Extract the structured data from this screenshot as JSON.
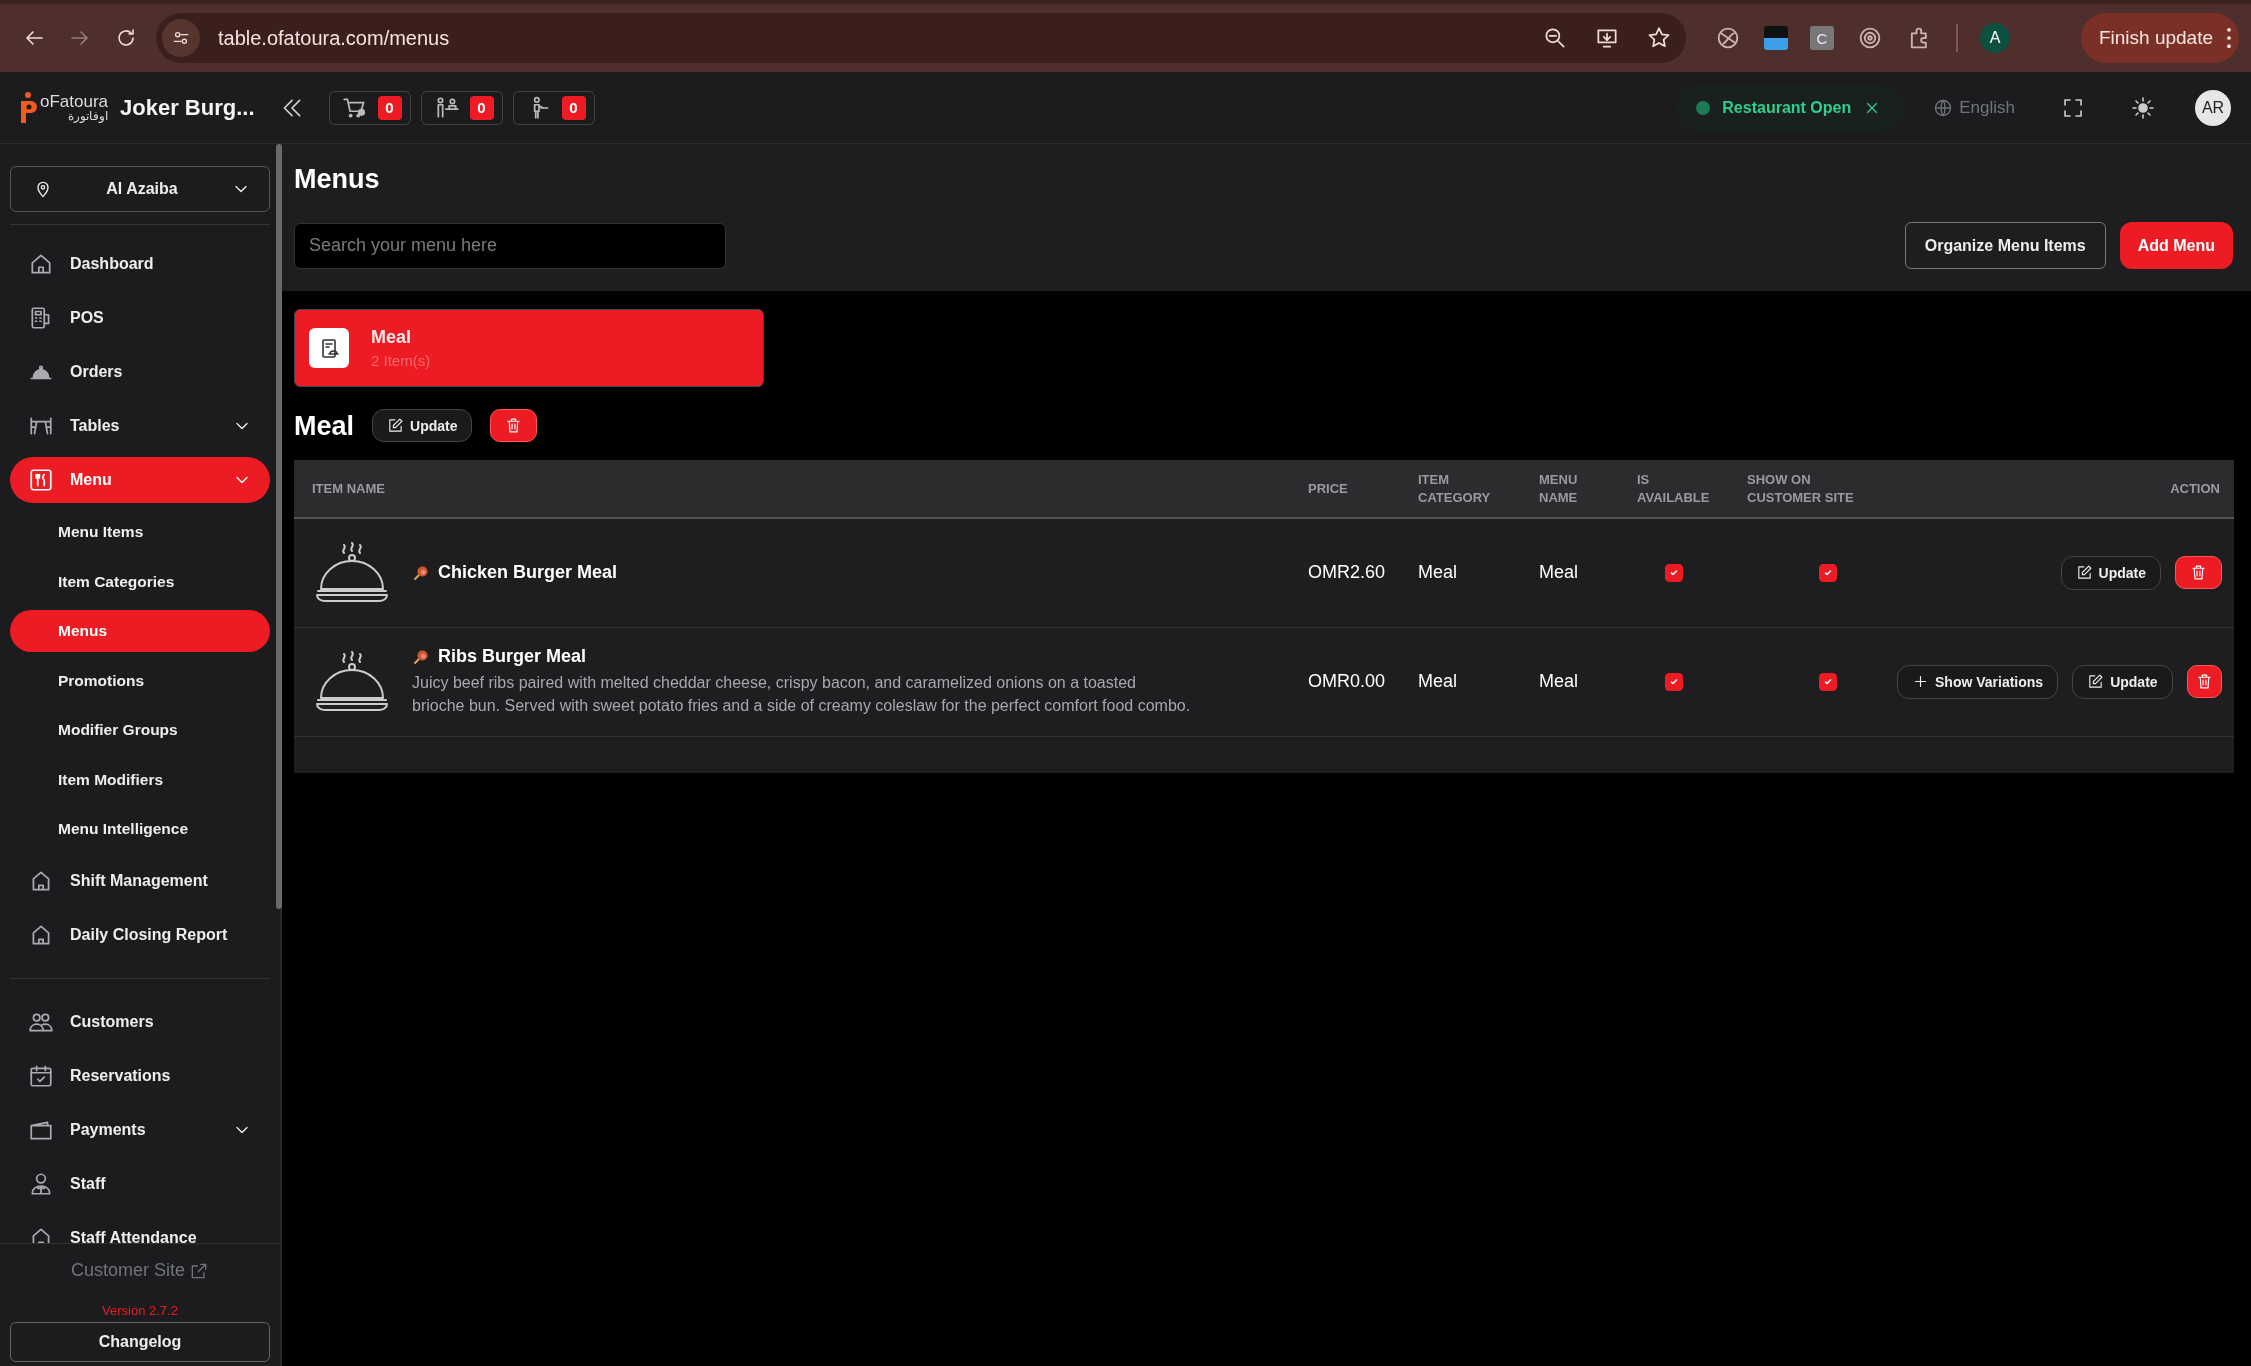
{
  "browser": {
    "url": "table.ofatoura.com/menus",
    "extension_letter": "C",
    "profile_initial": "A",
    "update_button": "Finish update"
  },
  "header": {
    "brand": "oFatoura",
    "brand_arabic": "اوفاتورة",
    "restaurant": "Joker Burg...",
    "counters": [
      {
        "kind": "cart",
        "count": "0"
      },
      {
        "kind": "dine_in",
        "count": "0"
      },
      {
        "kind": "waiter",
        "count": "0"
      }
    ],
    "status": {
      "label": "Restaurant Open",
      "open": true
    },
    "language": "English",
    "avatar": "AR"
  },
  "sidebar": {
    "branch": "Al Azaiba",
    "sections": [
      [
        {
          "label": "Dashboard",
          "kind": "link",
          "selected": false
        },
        {
          "label": "POS",
          "kind": "link",
          "selected": false
        },
        {
          "label": "Orders",
          "kind": "link",
          "selected": false
        },
        {
          "label": "Tables",
          "kind": "group",
          "selected": false
        },
        {
          "label": "Menu",
          "kind": "group",
          "selected": true,
          "children": [
            {
              "label": "Menu Items",
              "selected": false
            },
            {
              "label": "Item Categories",
              "selected": false
            },
            {
              "label": "Menus",
              "selected": true
            },
            {
              "label": "Promotions",
              "selected": false
            },
            {
              "label": "Modifier Groups",
              "selected": false
            },
            {
              "label": "Item Modifiers",
              "selected": false
            },
            {
              "label": "Menu Intelligence",
              "selected": false
            }
          ]
        },
        {
          "label": "Shift Management",
          "kind": "link",
          "selected": false
        },
        {
          "label": "Daily Closing Report",
          "kind": "link",
          "selected": false
        }
      ],
      [
        {
          "label": "Customers",
          "kind": "link",
          "selected": false
        },
        {
          "label": "Reservations",
          "kind": "link",
          "selected": false
        },
        {
          "label": "Payments",
          "kind": "group",
          "selected": false
        },
        {
          "label": "Staff",
          "kind": "link",
          "selected": false
        },
        {
          "label": "Staff Attendance",
          "kind": "link",
          "selected": false
        }
      ]
    ],
    "customer_site": "Customer Site",
    "version": "Version 2.7.2",
    "changelog": "Changelog"
  },
  "page": {
    "title": "Menus",
    "search": {
      "placeholder": "Search your menu here"
    },
    "buttons": [
      {
        "kind": "outline",
        "label": "Organize Menu Items"
      },
      {
        "kind": "primary",
        "label": "Add Menu"
      }
    ]
  },
  "menus": [
    {
      "name": "Meal",
      "count": "2 Item(s)",
      "selected": true
    }
  ],
  "section": {
    "title": "Meal",
    "update": "Update"
  },
  "table": {
    "columns": [
      "ITEM NAME",
      "PRICE",
      "ITEM CATEGORY",
      "MENU NAME",
      "IS AVAILABLE",
      "SHOW ON CUSTOMER SITE",
      "ACTION"
    ],
    "rows": [
      {
        "name": "Chicken Burger Meal",
        "price": "OMR2.60",
        "category": "Meal",
        "menu": "Meal",
        "available": true,
        "on_site": true,
        "actions": [
          {
            "kind": "edit",
            "label": "Update"
          },
          {
            "kind": "delete"
          }
        ]
      },
      {
        "name": "Ribs Burger Meal",
        "description": "Juicy beef ribs paired with melted cheddar cheese, crispy bacon, and caramelized onions on a toasted brioche bun. Served with sweet potato fries and a side of creamy coleslaw for the perfect comfort food combo.",
        "price": "OMR0.00",
        "category": "Meal",
        "menu": "Meal",
        "available": true,
        "on_site": true,
        "actions": [
          {
            "kind": "variations",
            "label": "Show Variations"
          },
          {
            "kind": "edit",
            "label": "Update"
          },
          {
            "kind": "delete"
          }
        ]
      }
    ]
  }
}
